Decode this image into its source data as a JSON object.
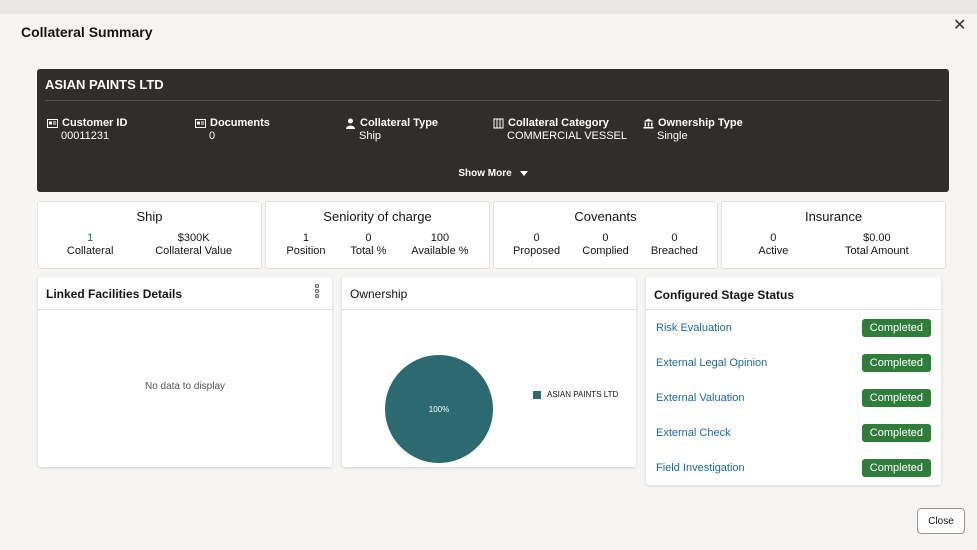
{
  "dialog": {
    "title": "Collateral Summary",
    "close_icon": "close-icon"
  },
  "header": {
    "name": "ASIAN PAINTS LTD",
    "fields": [
      {
        "label": "Customer ID",
        "value": "00011231",
        "icon": "id-card-icon"
      },
      {
        "label": "Documents",
        "value": "0",
        "icon": "document-icon"
      },
      {
        "label": "Collateral Type",
        "value": "Ship",
        "icon": "person-icon"
      },
      {
        "label": "Collateral Category",
        "value": "COMMERCIAL VESSEL",
        "icon": "building-icon"
      },
      {
        "label": "Ownership Type",
        "value": "Single",
        "icon": "bank-icon"
      }
    ],
    "show_more": "Show More"
  },
  "stats": [
    {
      "title": "Ship",
      "cells": [
        {
          "num": "1",
          "label": "Collateral"
        },
        {
          "num": "$300K",
          "label": "Collateral Value"
        }
      ]
    },
    {
      "title": "Seniority of charge",
      "cells": [
        {
          "num": "1",
          "label": "Position"
        },
        {
          "num": "0",
          "label": "Total %"
        },
        {
          "num": "100",
          "label": "Available %"
        }
      ]
    },
    {
      "title": "Covenants",
      "cells": [
        {
          "num": "0",
          "label": "Proposed"
        },
        {
          "num": "0",
          "label": "Complied"
        },
        {
          "num": "0",
          "label": "Breached"
        }
      ]
    },
    {
      "title": "Insurance",
      "cells": [
        {
          "num": "0",
          "label": "Active"
        },
        {
          "num": "$0.00",
          "label": "Total Amount"
        }
      ]
    }
  ],
  "linked": {
    "title": "Linked Facilities Details",
    "empty": "No data to display"
  },
  "ownership": {
    "title": "Ownership",
    "chart_data": {
      "type": "pie",
      "categories": [
        "ASIAN PAINTS LTD"
      ],
      "values": [
        100
      ],
      "labels": [
        "100%"
      ],
      "colors": [
        "#2b6a70"
      ],
      "legend": "right"
    }
  },
  "stages": {
    "title": "Configured Stage Status",
    "items": [
      {
        "name": "Risk Evaluation",
        "status": "Completed"
      },
      {
        "name": "External Legal Opinion",
        "status": "Completed"
      },
      {
        "name": "External Valuation",
        "status": "Completed"
      },
      {
        "name": "External Check",
        "status": "Completed"
      },
      {
        "name": "Field Investigation",
        "status": "Completed"
      }
    ]
  },
  "footer": {
    "close_label": "Close"
  },
  "colors": {
    "header_bg": "#312d2a",
    "accent_link": "#1a6aa8",
    "badge_green": "#2f7d3a",
    "pie_teal": "#2b6a70"
  }
}
